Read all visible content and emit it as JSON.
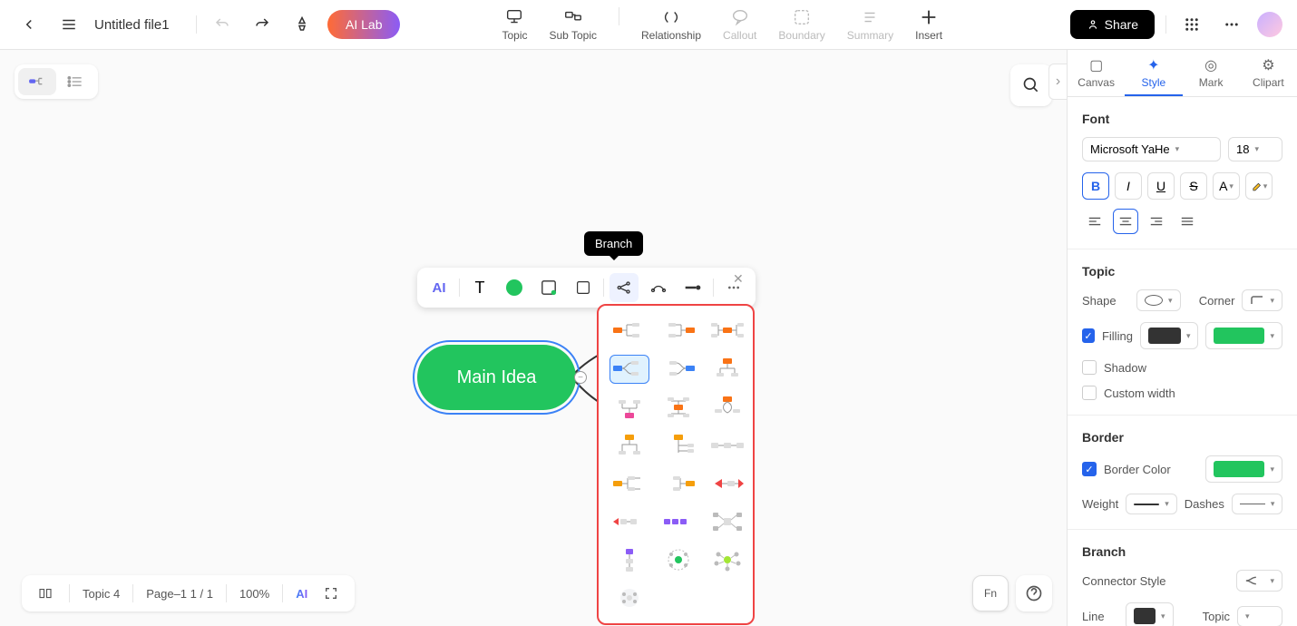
{
  "header": {
    "title": "Untitled file1",
    "ai_lab": "AI Lab",
    "share": "Share"
  },
  "tools": {
    "topic": "Topic",
    "sub_topic": "Sub Topic",
    "relationship": "Relationship",
    "callout": "Callout",
    "boundary": "Boundary",
    "summary": "Summary",
    "insert": "Insert"
  },
  "tooltip": {
    "branch": "Branch"
  },
  "node": {
    "main_idea": "Main Idea"
  },
  "float_toolbar": {
    "ai": "AI",
    "text": "T"
  },
  "panel_tabs": {
    "canvas": "Canvas",
    "style": "Style",
    "mark": "Mark",
    "clipart": "Clipart"
  },
  "font": {
    "section": "Font",
    "family": "Microsoft YaHe",
    "size": "18",
    "bold": "B",
    "italic": "I",
    "underline": "U",
    "strike": "S",
    "color": "A"
  },
  "topic": {
    "section": "Topic",
    "shape": "Shape",
    "corner": "Corner",
    "filling": "Filling",
    "shadow": "Shadow",
    "custom_width": "Custom width"
  },
  "border": {
    "section": "Border",
    "color": "Border Color",
    "weight": "Weight",
    "dashes": "Dashes"
  },
  "branch": {
    "section": "Branch",
    "connector": "Connector Style",
    "line": "Line",
    "topic": "Topic"
  },
  "status": {
    "topic_count": "Topic 4",
    "page": "Page–1  1 / 1",
    "zoom": "100%",
    "ai": "AI"
  },
  "colors": {
    "accent_green": "#22c55e",
    "accent_blue": "#2563eb",
    "popup_border": "#ef4444"
  }
}
